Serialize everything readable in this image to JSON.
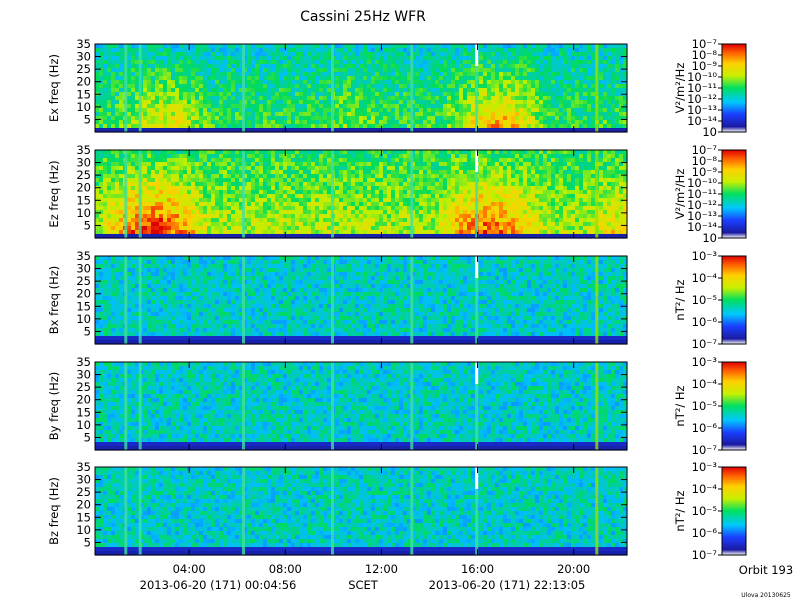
{
  "title": "Cassini 25Hz WFR",
  "time_axis": {
    "ticks": [
      "04:00",
      "08:00",
      "12:00",
      "16:00",
      "20:00"
    ],
    "start_label": "2013-06-20 (171) 00:04:56",
    "center_label": "SCET",
    "end_label": "2013-06-20 (171) 22:13:05"
  },
  "orbit_label": "Orbit 193",
  "footer_label": "Ulova 20130625",
  "chart_data": [
    {
      "type": "heatmap",
      "ylabel": "Ex freq (Hz)",
      "yticks": [
        5,
        10,
        15,
        20,
        25,
        30,
        35
      ],
      "ylim": [
        0,
        35
      ],
      "colorbar": {
        "unit": "V²/m²/Hz",
        "ticks": [
          "10⁻⁷",
          "10⁻⁸",
          "10⁻⁹",
          "10⁻¹⁰",
          "10⁻¹¹",
          "10⁻¹²",
          "10⁻¹³",
          "10⁻¹⁴",
          "10"
        ]
      }
    },
    {
      "type": "heatmap",
      "ylabel": "Ez freq (Hz)",
      "yticks": [
        5,
        10,
        15,
        20,
        25,
        30,
        35
      ],
      "ylim": [
        0,
        35
      ],
      "colorbar": {
        "unit": "V²/m²/Hz",
        "ticks": [
          "10⁻⁷",
          "10⁻⁸",
          "10⁻⁹",
          "10⁻¹⁰",
          "10⁻¹¹",
          "10⁻¹²",
          "10⁻¹³",
          "10⁻¹⁴",
          "10"
        ]
      }
    },
    {
      "type": "heatmap",
      "ylabel": "Bx freq (Hz)",
      "yticks": [
        5,
        10,
        15,
        20,
        25,
        30,
        35
      ],
      "ylim": [
        0,
        35
      ],
      "colorbar": {
        "unit": "nT²/ Hz",
        "ticks": [
          "10⁻³",
          "10⁻⁴",
          "10⁻⁵",
          "10⁻⁶",
          "10⁻⁷"
        ]
      }
    },
    {
      "type": "heatmap",
      "ylabel": "By freq (Hz)",
      "yticks": [
        5,
        10,
        15,
        20,
        25,
        30,
        35
      ],
      "ylim": [
        0,
        35
      ],
      "colorbar": {
        "unit": "nT²/ Hz",
        "ticks": [
          "10⁻³",
          "10⁻⁴",
          "10⁻⁵",
          "10⁻⁶",
          "10⁻⁷"
        ]
      }
    },
    {
      "type": "heatmap",
      "ylabel": "Bz freq (Hz)",
      "yticks": [
        5,
        10,
        15,
        20,
        25,
        30,
        35
      ],
      "ylim": [
        0,
        35
      ],
      "colorbar": {
        "unit": "nT²/ Hz",
        "ticks": [
          "10⁻³",
          "10⁻⁴",
          "10⁻⁵",
          "10⁻⁶",
          "10⁻⁷"
        ]
      }
    }
  ]
}
